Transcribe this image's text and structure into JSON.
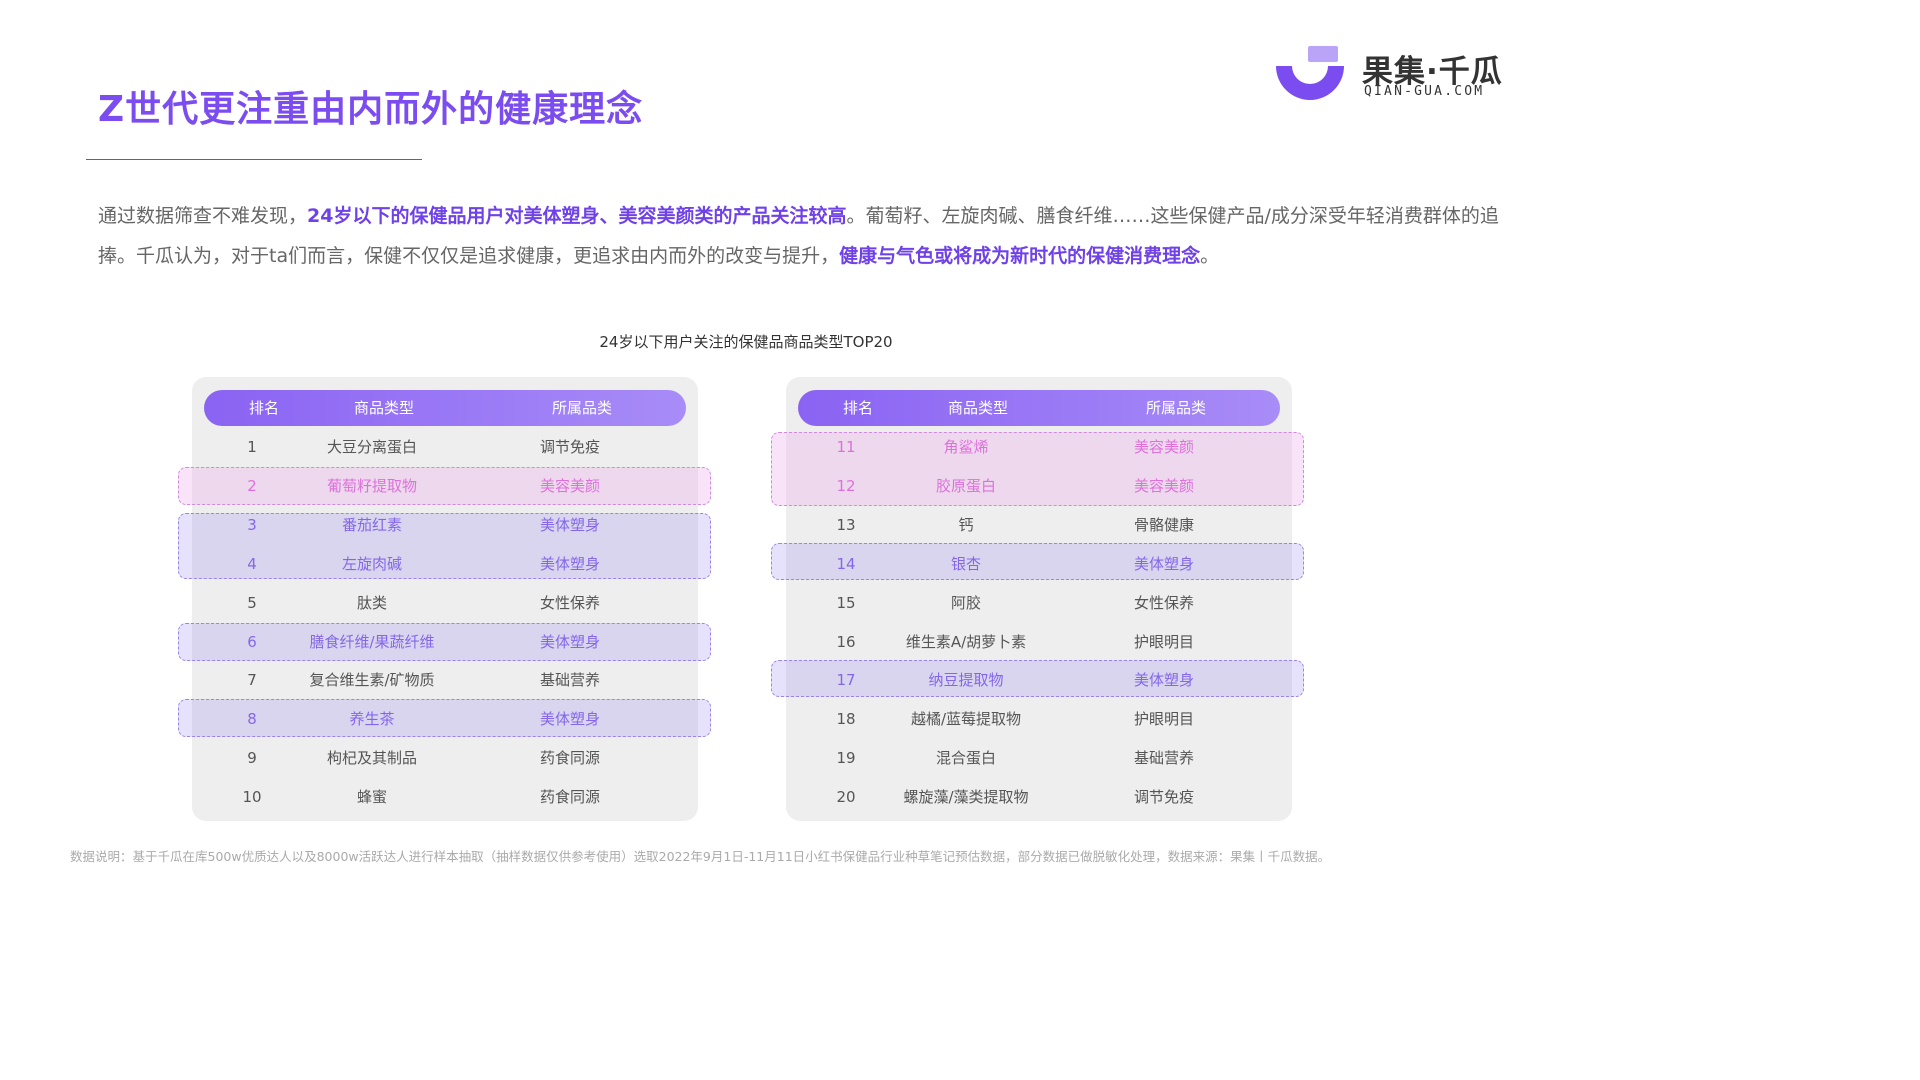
{
  "title": "Z世代更注重由内而外的健康理念",
  "logo": {
    "name_cn": "果集·千瓜",
    "name_en": "QIAN-GUA.COM"
  },
  "intro": {
    "p1": "通过数据筛查不难发现，",
    "h1": "24岁以下的保健品用户对美体塑身、美容美颜类的产品关注较高",
    "p2": "。葡萄籽、左旋肉碱、膳食纤维……这些保健产品/成分深受年轻消费群体的追捧。千瓜认为，对于ta们而言，保健不仅仅是追求健康，更追求由内而外的改变与提升，",
    "h2": "健康与气色或将成为新时代的保健消费理念",
    "p3": "。"
  },
  "chart_data": {
    "type": "table",
    "title": "24岁以下用户关注的保健品商品类型TOP20",
    "columns": [
      "排名",
      "商品类型",
      "所属品类"
    ],
    "rows": [
      [
        "1",
        "大豆分离蛋白",
        "调节免疫"
      ],
      [
        "2",
        "葡萄籽提取物",
        "美容美颜"
      ],
      [
        "3",
        "番茄红素",
        "美体塑身"
      ],
      [
        "4",
        "左旋肉碱",
        "美体塑身"
      ],
      [
        "5",
        "肽类",
        "女性保养"
      ],
      [
        "6",
        "膳食纤维/果蔬纤维",
        "美体塑身"
      ],
      [
        "7",
        "复合维生素/矿物质",
        "基础营养"
      ],
      [
        "8",
        "养生茶",
        "美体塑身"
      ],
      [
        "9",
        "枸杞及其制品",
        "药食同源"
      ],
      [
        "10",
        "蜂蜜",
        "药食同源"
      ],
      [
        "11",
        "角鲨烯",
        "美容美颜"
      ],
      [
        "12",
        "胶原蛋白",
        "美容美颜"
      ],
      [
        "13",
        "钙",
        "骨骼健康"
      ],
      [
        "14",
        "银杏",
        "美体塑身"
      ],
      [
        "15",
        "阿胶",
        "女性保养"
      ],
      [
        "16",
        "维生素A/胡萝卜素",
        "护眼明目"
      ],
      [
        "17",
        "纳豆提取物",
        "美体塑身"
      ],
      [
        "18",
        "越橘/蓝莓提取物",
        "护眼明目"
      ],
      [
        "19",
        "混合蛋白",
        "基础营养"
      ],
      [
        "20",
        "螺旋藻/藻类提取物",
        "调节免疫"
      ]
    ],
    "highlight_colors": {
      "美容美颜": "#d74fd2",
      "美体塑身": "#7554e8"
    }
  },
  "footnote": "数据说明：基于千瓜在库500w优质达人以及8000w活跃达人进行样本抽取（抽样数据仅供参考使用）选取2022年9月1日-11月11日小红书保健品行业种草笔记预估数据，部分数据已做脱敏化处理，数据来源：果集丨千瓜数据。",
  "colors": {
    "accent": "#7b4cf0",
    "header_gradient_start": "#8a63f3",
    "header_gradient_end": "#a88cf7"
  }
}
